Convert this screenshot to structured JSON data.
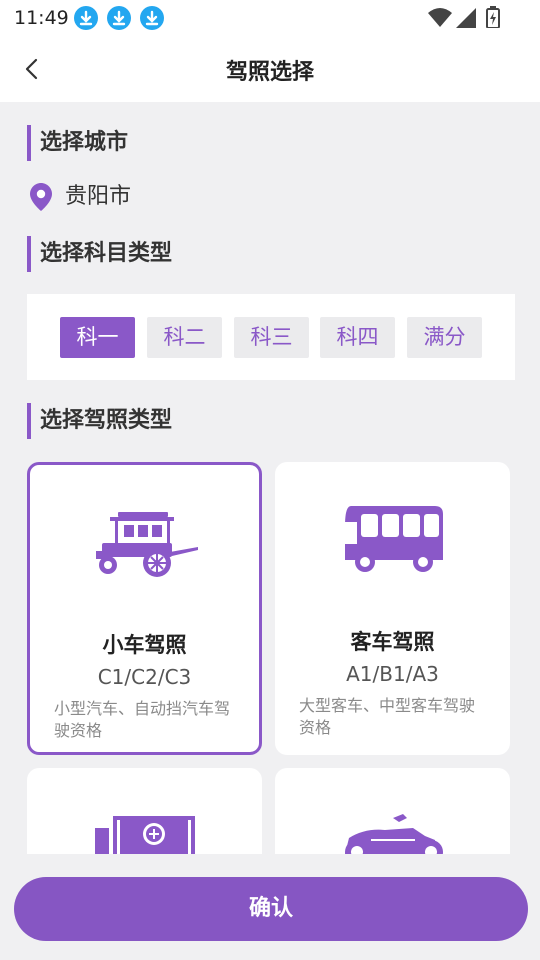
{
  "status_bar": {
    "time": "11:49"
  },
  "header": {
    "title": "驾照选择"
  },
  "sections": {
    "city": "选择城市",
    "subject": "选择科目类型",
    "license": "选择驾照类型"
  },
  "city": {
    "name": "贵阳市"
  },
  "subjects": [
    {
      "label": "科一",
      "selected": true
    },
    {
      "label": "科二",
      "selected": false
    },
    {
      "label": "科三",
      "selected": false
    },
    {
      "label": "科四",
      "selected": false
    },
    {
      "label": "满分",
      "selected": false
    }
  ],
  "license_types": [
    {
      "name": "小车驾照",
      "code": "C1/C2/C3",
      "desc": "小型汽车、自动挡汽车驾驶资格",
      "icon": "car-icon",
      "selected": true
    },
    {
      "name": "客车驾照",
      "code": "A1/B1/A3",
      "desc": "大型客车、中型客车驾驶资格",
      "icon": "bus-icon",
      "selected": false
    },
    {
      "name": "",
      "code": "",
      "desc": "",
      "icon": "truck-icon",
      "selected": false
    },
    {
      "name": "",
      "code": "",
      "desc": "",
      "icon": "motorcycle-icon",
      "selected": false
    }
  ],
  "confirm_label": "确认",
  "colors": {
    "accent": "#8a58c8",
    "download_badge": "#23a7f0"
  }
}
